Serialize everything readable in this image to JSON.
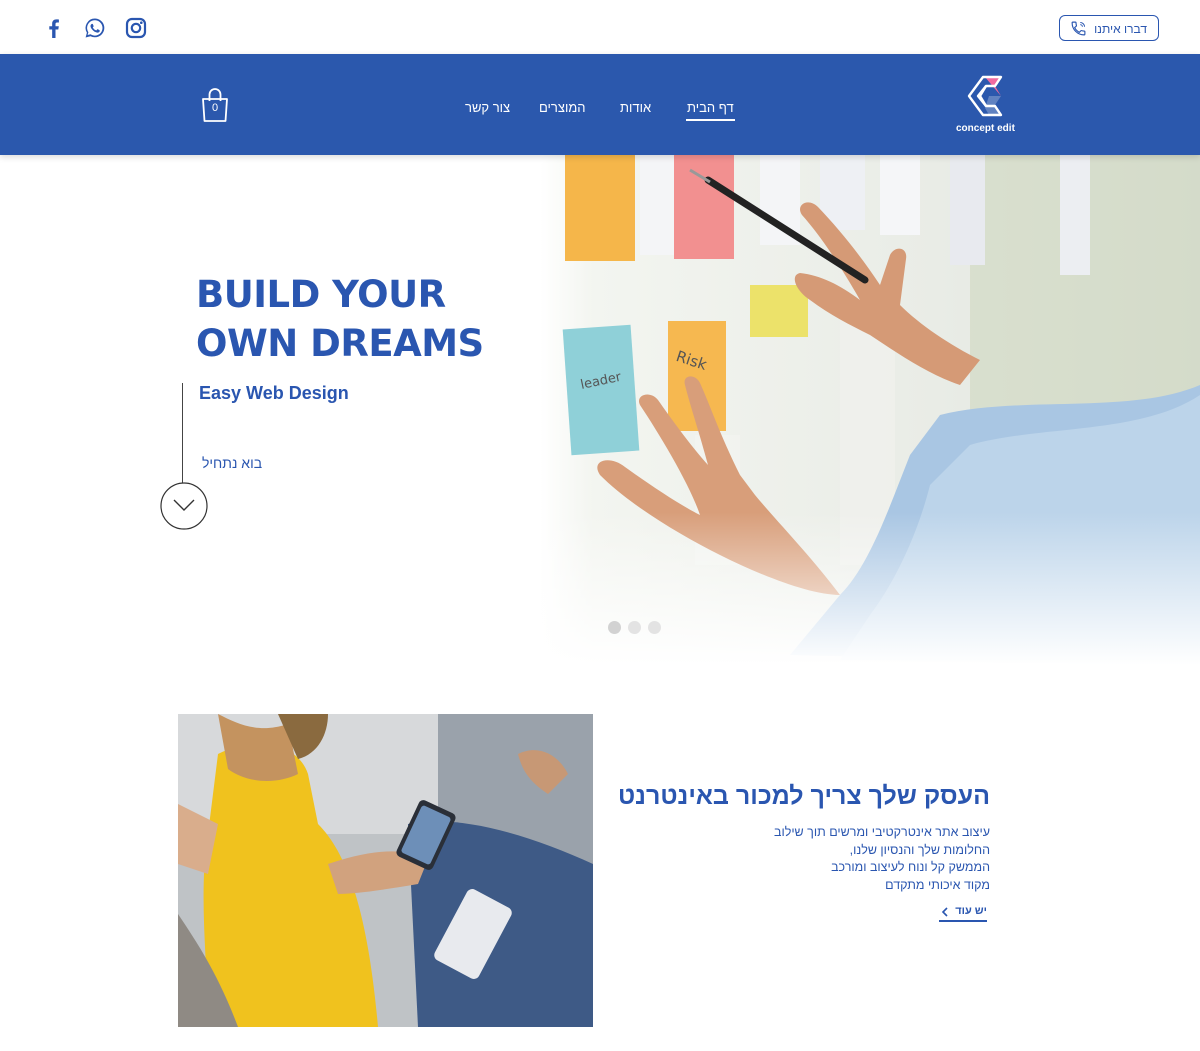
{
  "topbar": {
    "contact_label": "דברו איתנו",
    "social": [
      "facebook-icon",
      "whatsapp-icon",
      "instagram-icon"
    ]
  },
  "navbar": {
    "logo_text": "concept edit",
    "items": [
      {
        "label": "דף הבית",
        "active": true
      },
      {
        "label": "אודות",
        "active": false
      },
      {
        "label": "המוצרים",
        "active": false
      },
      {
        "label": "צור קשר",
        "active": false
      }
    ],
    "cart_count": "0"
  },
  "hero": {
    "title_line1": "BUILD YOUR",
    "title_line2": "OWN DREAMS",
    "subtitle": "Easy Web Design",
    "cta": "בוא נתחיל",
    "slides_total": 3,
    "active_slide": 1
  },
  "section": {
    "title": "העסק שלך צריך למכור באינטרנט",
    "body_lines": [
      "עיצוב אתר אינטרקטיבי ומרשים תוך שילוב",
      "החלומות שלך והנסיון שלנו,",
      "הממשק קל ונוח לעיצוב ומורכב",
      "מקוד איכותי מתקדם"
    ],
    "more_label": "יש עוד"
  },
  "colors": {
    "brand_blue": "#2b58ad",
    "text_blue": "#2a56b0",
    "logo_pink": "#f06aa0"
  }
}
